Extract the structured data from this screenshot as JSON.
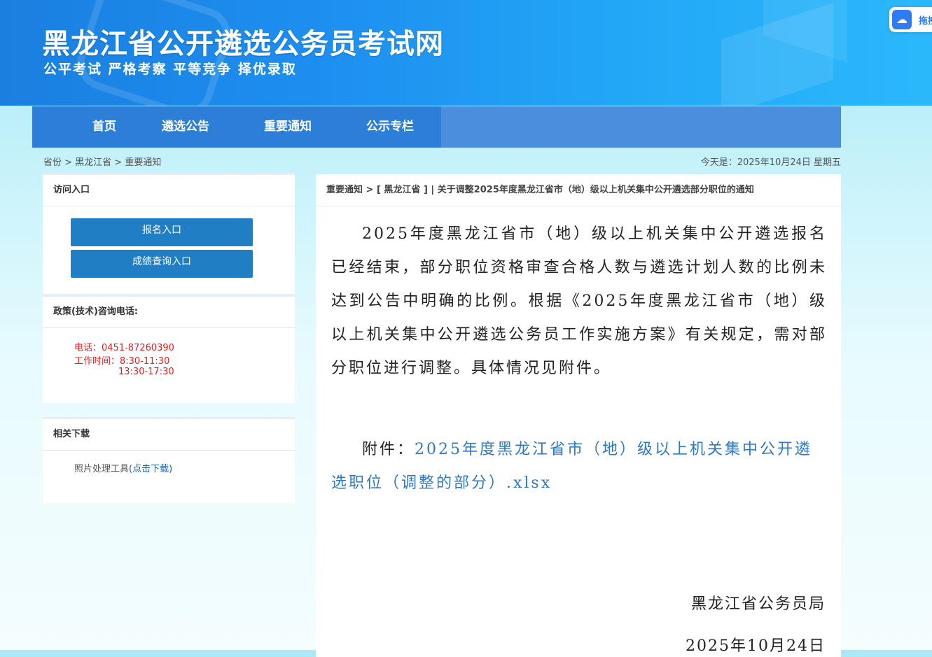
{
  "header": {
    "site_title": "黑龙江省公开遴选公务员考试网",
    "slogan": "公平考试 严格考察 平等竞争 择优录取",
    "baidu_label": "拖拽"
  },
  "nav": {
    "items": [
      "首页",
      "遴选公告",
      "重要通知",
      "公示专栏"
    ]
  },
  "breadcrumb": {
    "text": "省份 > 黑龙江省 > 重要通知",
    "today": "今天是：2025年10月24日 星期五"
  },
  "sidebar": {
    "access": {
      "title": "访问入口",
      "buttons": [
        "报名入口",
        "成绩查询入口"
      ]
    },
    "hotline": {
      "title": "政策(技术)咨询电话:",
      "phone": "电话：0451-87260390",
      "hours1": "工作时间：8:30-11:30",
      "hours2": "13:30-17:30"
    },
    "downloads": {
      "title": "相关下载",
      "item_text": "照片处理工具",
      "item_link": "(点击下载)"
    }
  },
  "article": {
    "crumb": "重要通知 > [ 黑龙江省 ] | 关于调整2025年度黑龙江省市（地）级以上机关集中公开遴选部分职位的通知",
    "body": "2025年度黑龙江省市（地）级以上机关集中公开遴选报名已经结束，部分职位资格审查合格人数与遴选计划人数的比例未达到公告中明确的比例。根据《2025年度黑龙江省市（地）级以上机关集中公开遴选公务员工作实施方案》有关规定，需对部分职位进行调整。具体情况见附件。",
    "attach_label": "附件：",
    "attach_link": "2025年度黑龙江省市（地）级以上机关集中公开遴选职位（调整的部分）.xlsx",
    "signature": "黑龙江省公务员局",
    "date": "2025年10月24日"
  },
  "colors": {
    "nav_bg": "#2c7ed6",
    "button_bg": "#1f7ec4",
    "hotline_text": "#e02020",
    "link": "#2f78c4"
  }
}
